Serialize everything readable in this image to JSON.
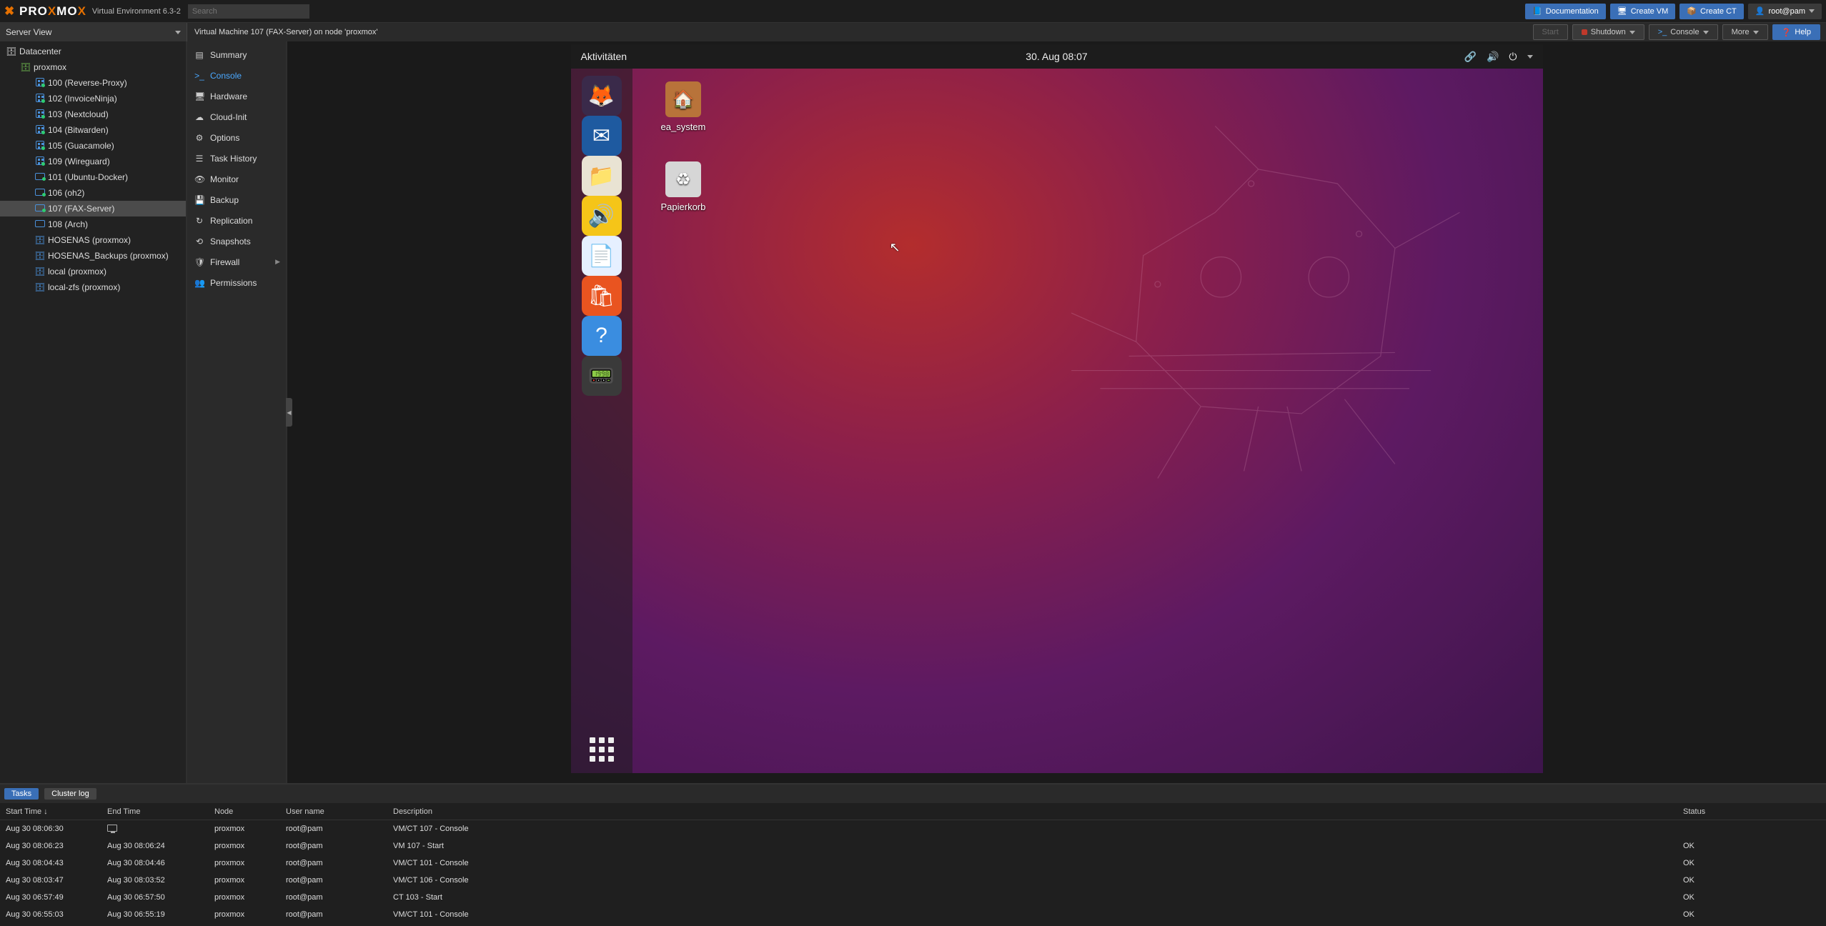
{
  "header": {
    "product": "PROXMOX",
    "version": "Virtual Environment 6.3-2",
    "search_placeholder": "Search",
    "doc": "Documentation",
    "create_vm": "Create VM",
    "create_ct": "Create CT",
    "user": "root@pam"
  },
  "subbar": {
    "server_view": "Server View",
    "title": "Virtual Machine 107 (FAX-Server) on node 'proxmox'",
    "start": "Start",
    "shutdown": "Shutdown",
    "console": "Console",
    "more": "More",
    "help": "Help"
  },
  "tree": {
    "datacenter": "Datacenter",
    "node": "proxmox",
    "guests": [
      {
        "id": "100",
        "name": "100 (Reverse-Proxy)",
        "type": "lxc",
        "on": true
      },
      {
        "id": "102",
        "name": "102 (InvoiceNinja)",
        "type": "lxc",
        "on": true
      },
      {
        "id": "103",
        "name": "103 (Nextcloud)",
        "type": "lxc",
        "on": true
      },
      {
        "id": "104",
        "name": "104 (Bitwarden)",
        "type": "lxc",
        "on": true
      },
      {
        "id": "105",
        "name": "105 (Guacamole)",
        "type": "lxc",
        "on": true
      },
      {
        "id": "109",
        "name": "109 (Wireguard)",
        "type": "lxc",
        "on": true
      },
      {
        "id": "101",
        "name": "101 (Ubuntu-Docker)",
        "type": "vm",
        "on": true
      },
      {
        "id": "106",
        "name": "106 (oh2)",
        "type": "vm",
        "on": true
      },
      {
        "id": "107",
        "name": "107 (FAX-Server)",
        "type": "vm",
        "on": true,
        "selected": true
      },
      {
        "id": "108",
        "name": "108 (Arch)",
        "type": "vm",
        "on": false
      }
    ],
    "storage": [
      {
        "name": "HOSENAS (proxmox)"
      },
      {
        "name": "HOSENAS_Backups (proxmox)"
      },
      {
        "name": "local (proxmox)"
      },
      {
        "name": "local-zfs (proxmox)"
      }
    ]
  },
  "submenu": {
    "items": [
      {
        "label": "Summary",
        "icon": "chart"
      },
      {
        "label": "Console",
        "icon": "terminal",
        "active": true
      },
      {
        "label": "Hardware",
        "icon": "desktop"
      },
      {
        "label": "Cloud-Init",
        "icon": "cloud"
      },
      {
        "label": "Options",
        "icon": "gear"
      },
      {
        "label": "Task History",
        "icon": "list"
      },
      {
        "label": "Monitor",
        "icon": "eye"
      },
      {
        "label": "Backup",
        "icon": "save"
      },
      {
        "label": "Replication",
        "icon": "sync"
      },
      {
        "label": "Snapshots",
        "icon": "history"
      },
      {
        "label": "Firewall",
        "icon": "shield",
        "sub": true
      },
      {
        "label": "Permissions",
        "icon": "users"
      }
    ]
  },
  "console": {
    "activities": "Aktivitäten",
    "datetime": "30. Aug  08:07",
    "desktop": [
      {
        "label": "ea_system",
        "icon": "home"
      },
      {
        "label": "Papierkorb",
        "icon": "trash"
      }
    ],
    "dock": [
      {
        "name": "firefox",
        "bg": "#3a2a4a",
        "fg": "#ff7139",
        "glyph": "🦊"
      },
      {
        "name": "thunderbird",
        "bg": "#1e5aa0",
        "fg": "#fff",
        "glyph": "✉"
      },
      {
        "name": "files",
        "bg": "#e9e3d3",
        "fg": "#8a6d3b",
        "glyph": "📁"
      },
      {
        "name": "rhythmbox",
        "bg": "#f5c518",
        "fg": "#333",
        "glyph": "🔊"
      },
      {
        "name": "writer",
        "bg": "#e6f0ff",
        "fg": "#2a6bb0",
        "glyph": "📄"
      },
      {
        "name": "software",
        "bg": "#e95420",
        "fg": "#fff",
        "glyph": "🛍"
      },
      {
        "name": "help",
        "bg": "#3a8de0",
        "fg": "#fff",
        "glyph": "?"
      },
      {
        "name": "settings",
        "bg": "#3a3a3a",
        "fg": "#ddd",
        "glyph": "📟"
      }
    ]
  },
  "tasks": {
    "tab_tasks": "Tasks",
    "tab_cluster": "Cluster log",
    "cols": {
      "start": "Start Time",
      "end": "End Time",
      "node": "Node",
      "user": "User name",
      "desc": "Description",
      "status": "Status"
    },
    "rows": [
      {
        "start": "Aug 30 08:06:30",
        "end": "",
        "end_live": true,
        "node": "proxmox",
        "user": "root@pam",
        "desc": "VM/CT 107 - Console",
        "status": ""
      },
      {
        "start": "Aug 30 08:06:23",
        "end": "Aug 30 08:06:24",
        "node": "proxmox",
        "user": "root@pam",
        "desc": "VM 107 - Start",
        "status": "OK"
      },
      {
        "start": "Aug 30 08:04:43",
        "end": "Aug 30 08:04:46",
        "node": "proxmox",
        "user": "root@pam",
        "desc": "VM/CT 101 - Console",
        "status": "OK"
      },
      {
        "start": "Aug 30 08:03:47",
        "end": "Aug 30 08:03:52",
        "node": "proxmox",
        "user": "root@pam",
        "desc": "VM/CT 106 - Console",
        "status": "OK"
      },
      {
        "start": "Aug 30 06:57:49",
        "end": "Aug 30 06:57:50",
        "node": "proxmox",
        "user": "root@pam",
        "desc": "CT 103 - Start",
        "status": "OK"
      },
      {
        "start": "Aug 30 06:55:03",
        "end": "Aug 30 06:55:19",
        "node": "proxmox",
        "user": "root@pam",
        "desc": "VM/CT 101 - Console",
        "status": "OK"
      }
    ]
  }
}
